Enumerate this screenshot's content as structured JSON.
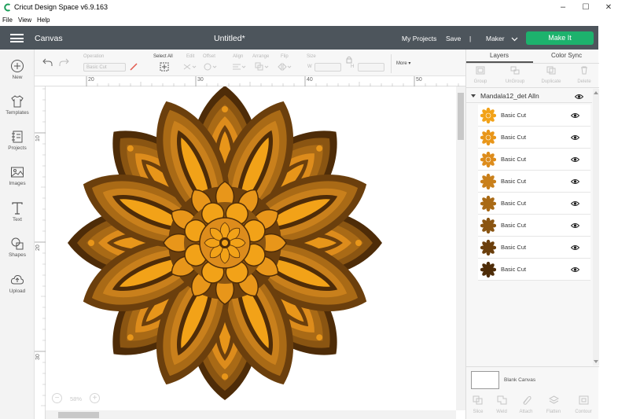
{
  "window": {
    "title": "Cricut Design Space  v6.9.163",
    "menu": [
      "File",
      "View",
      "Help"
    ],
    "controls": [
      "–",
      "☐",
      "✕"
    ]
  },
  "header": {
    "section": "Canvas",
    "document": "Untitled*",
    "my_projects": "My Projects",
    "save": "Save",
    "divider": "|",
    "machine": "Maker",
    "make_it": "Make It",
    "colors": {
      "bar": "#4d555c",
      "make_it": "#1db26d"
    }
  },
  "leftnav": {
    "items": [
      {
        "label": "New",
        "icon": "plus-circle-icon"
      },
      {
        "label": "Templates",
        "icon": "shirt-icon"
      },
      {
        "label": "Projects",
        "icon": "projects-icon"
      },
      {
        "label": "Images",
        "icon": "image-icon"
      },
      {
        "label": "Text",
        "icon": "text-icon"
      },
      {
        "label": "Shapes",
        "icon": "shapes-icon"
      },
      {
        "label": "Upload",
        "icon": "upload-cloud-icon"
      }
    ]
  },
  "toolbar": {
    "operation_label": "Operation",
    "operation_value": "Basic Cut",
    "select_all": "Select All",
    "edit": "Edit",
    "offset": "Offset",
    "align": "Align",
    "arrange": "Arrange",
    "flip": "Flip",
    "size": "Size",
    "w": "W",
    "h": "H",
    "more": "More ▾"
  },
  "rulers": {
    "top": [
      "20",
      "30",
      "40",
      "50"
    ],
    "left": [
      "10",
      "20",
      "30"
    ]
  },
  "zoom": {
    "value": "58%",
    "minus": "−",
    "plus": "+"
  },
  "panel": {
    "tabs": [
      "Layers",
      "Color Sync"
    ],
    "top_actions": [
      "Group",
      "UnGroup",
      "Duplicate",
      "Delete"
    ],
    "group_name": "Mandala12_det Alln",
    "layers": [
      {
        "name": "Basic Cut",
        "color": "#f2a218"
      },
      {
        "name": "Basic Cut",
        "color": "#e8961a"
      },
      {
        "name": "Basic Cut",
        "color": "#dd8c1c"
      },
      {
        "name": "Basic Cut",
        "color": "#c9801c"
      },
      {
        "name": "Basic Cut",
        "color": "#a96a16"
      },
      {
        "name": "Basic Cut",
        "color": "#8a5512"
      },
      {
        "name": "Basic Cut",
        "color": "#6b3f0d"
      },
      {
        "name": "Basic Cut",
        "color": "#4e2c08"
      }
    ],
    "blank_canvas": "Blank Canvas",
    "bottom_actions": [
      "Slice",
      "Weld",
      "Attach",
      "Flatten",
      "Contour"
    ]
  }
}
